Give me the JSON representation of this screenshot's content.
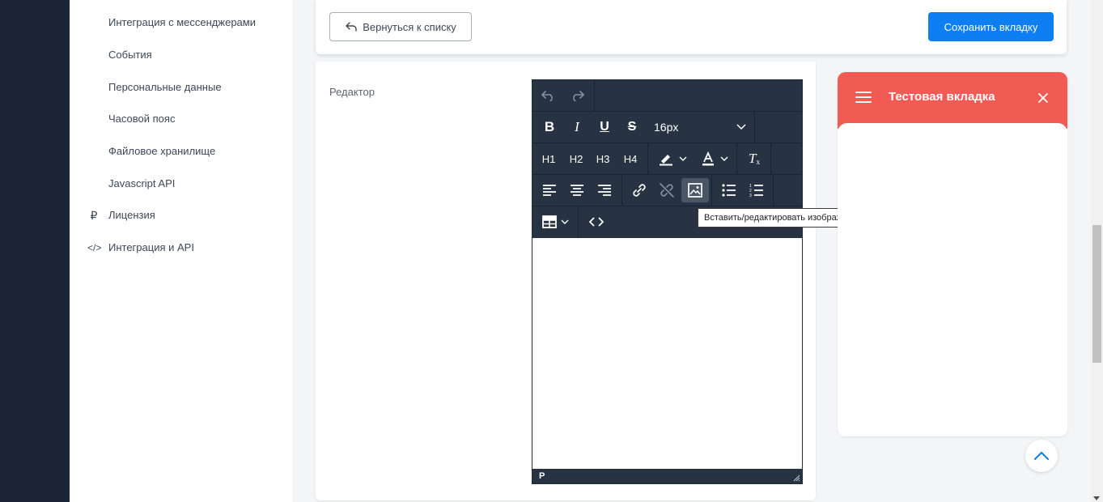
{
  "sidebar": {
    "items": [
      {
        "label": "Интеграция с мессенджерами"
      },
      {
        "label": "События"
      },
      {
        "label": "Персональные данные"
      },
      {
        "label": "Часовой пояс"
      },
      {
        "label": "Файловое хранилище"
      },
      {
        "label": "Javascript API"
      },
      {
        "label": "Лицензия",
        "icon": "ruble-icon"
      },
      {
        "label": "Интеграция и API",
        "icon": "code-icon"
      }
    ],
    "icons": {
      "ruble": "₽",
      "code": "</>"
    }
  },
  "header": {
    "back_label": "Вернуться к списку",
    "save_label": "Сохранить вкладку"
  },
  "form": {
    "editor_label": "Редактор"
  },
  "editor": {
    "font_size": "16px",
    "headings": [
      "H1",
      "H2",
      "H3",
      "H4"
    ],
    "status_path": "P",
    "tooltip": "Вставить/редактировать изображение",
    "active_button": "insert-image"
  },
  "preview": {
    "title": "Тестовая вкладка",
    "accent_color": "#f25a54"
  },
  "colors": {
    "primary": "#0d7ff2",
    "sidebar_dark": "#1c2537",
    "toolbar": "#273343"
  }
}
